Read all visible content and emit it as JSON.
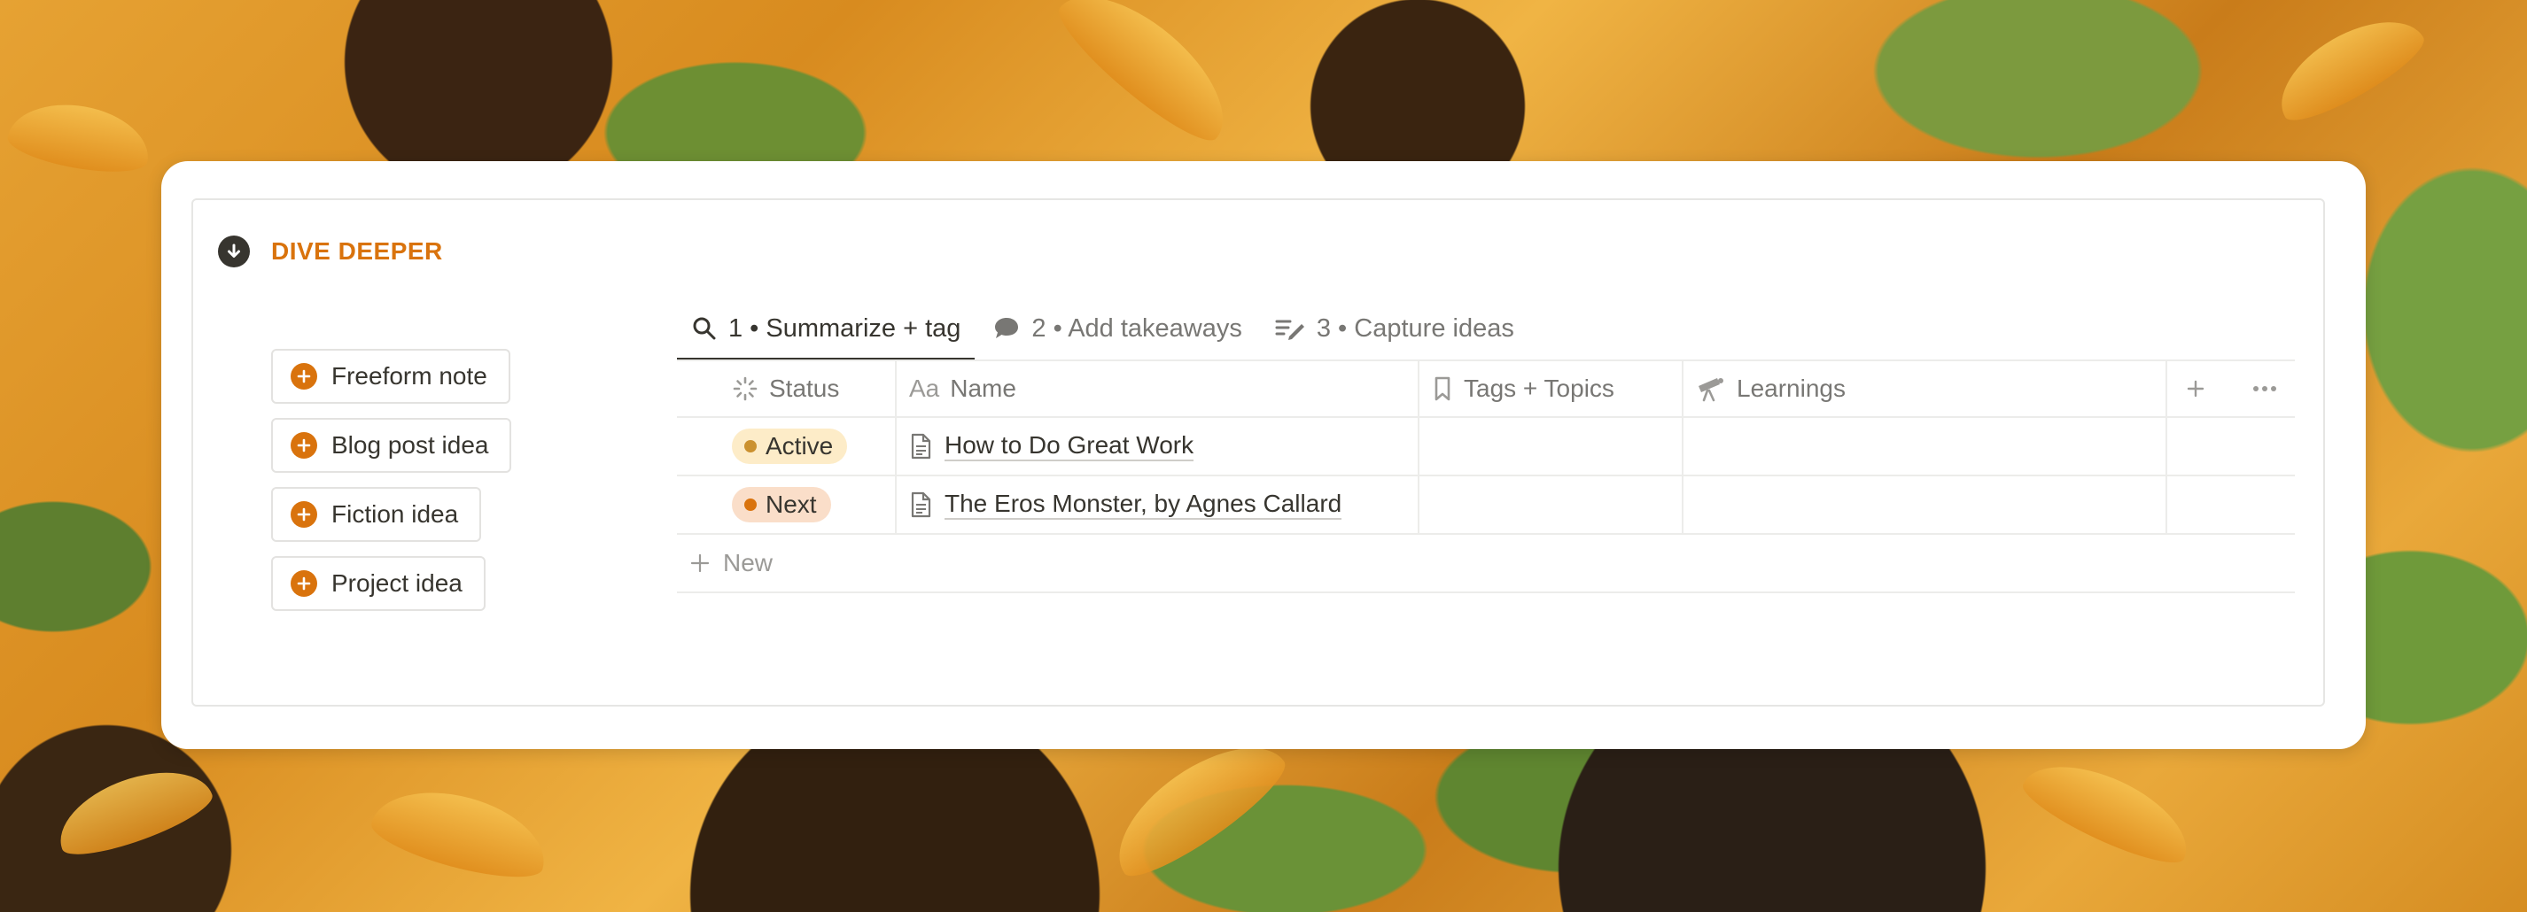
{
  "header": {
    "title": "DIVE DEEPER",
    "icon": "arrow-down-circle-icon"
  },
  "buttons": [
    {
      "label": "Freeform note",
      "icon": "plus-circle-icon"
    },
    {
      "label": "Blog post idea",
      "icon": "plus-circle-icon"
    },
    {
      "label": "Fiction idea",
      "icon": "plus-circle-icon"
    },
    {
      "label": "Project idea",
      "icon": "plus-circle-icon"
    }
  ],
  "tabs": [
    {
      "label": "1 • Summarize + tag",
      "icon": "search-icon",
      "active": true
    },
    {
      "label": "2 • Add takeaways",
      "icon": "speech-bubble-icon",
      "active": false
    },
    {
      "label": "3 • Capture ideas",
      "icon": "edit-list-icon",
      "active": false
    }
  ],
  "table": {
    "columns": [
      {
        "label": "Status",
        "icon": "status-spinner-icon"
      },
      {
        "label": "Name",
        "icon": "text-aa-icon",
        "icon_text": "Aa"
      },
      {
        "label": "Tags + Topics",
        "icon": "bookmark-icon"
      },
      {
        "label": "Learnings",
        "icon": "telescope-icon"
      }
    ],
    "rows": [
      {
        "status": "Active",
        "status_bg": "#fdecc8",
        "status_dot": "#cb912f",
        "name": "How to Do Great Work"
      },
      {
        "status": "Next",
        "status_bg": "#fadec9",
        "status_dot": "#d9730d",
        "name": "The Eros Monster, by Agnes Callard"
      }
    ],
    "new_label": "New"
  },
  "colors": {
    "accent": "#d9730d",
    "text": "#37352f",
    "muted": "#787774"
  }
}
